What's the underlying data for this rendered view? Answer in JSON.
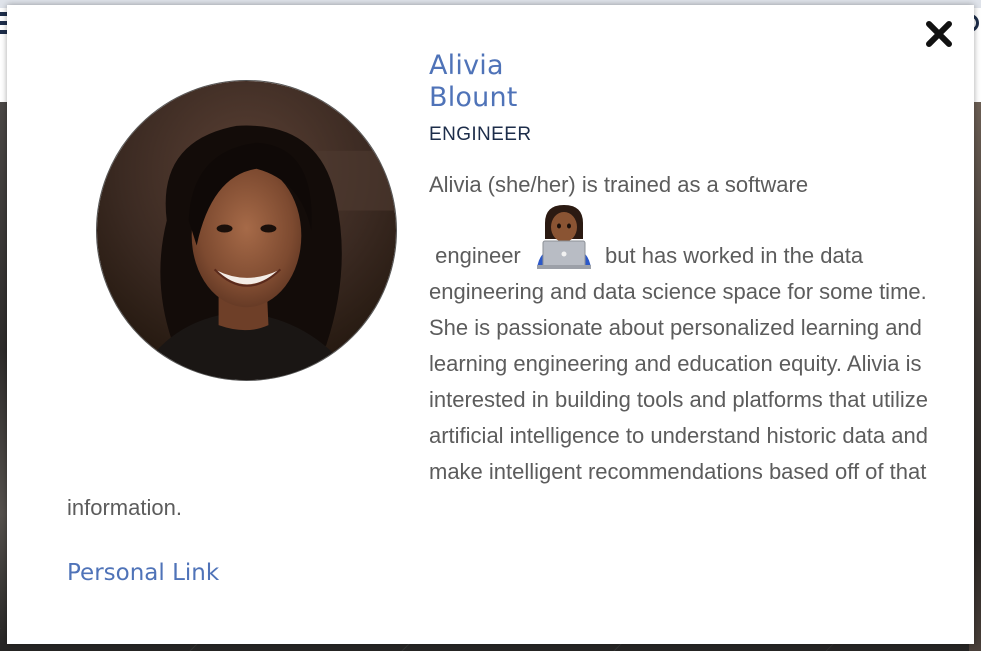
{
  "profile": {
    "first_name": "Alivia",
    "last_name": "Blount",
    "role": "ENGINEER",
    "bio_part1": "Alivia (she/her) is trained as a software",
    "bio_part2": "engineer",
    "bio_emoji": "technologist-icon",
    "bio_part3": "but has worked in the data engineering and data science space for some time. She is passionate about personalized learning and learning engineering and education equity. Alivia is interested in building tools and platforms that utilize artificial intelligence to understand historic data and make intelligent recommendations based off of that information.",
    "link_label": "Personal Link"
  },
  "modal": {
    "close_icon": "close-icon"
  },
  "colors": {
    "name": "#4f73b8",
    "role": "#1d2d4a",
    "body_text": "#5c5c5c",
    "link": "#4f73b8"
  }
}
